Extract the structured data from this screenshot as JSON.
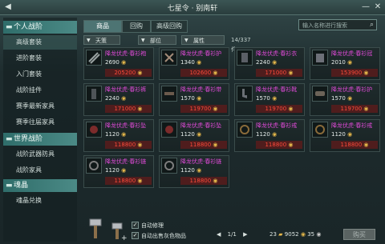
{
  "title": "七星令 · 别南轩",
  "sidebar": {
    "sections": [
      {
        "label": "个人战阶",
        "items": [
          {
            "label": "高级套装",
            "selected": true
          },
          {
            "label": "进阶套装"
          },
          {
            "label": "入门套装"
          },
          {
            "label": "战阶挂件"
          },
          {
            "label": "赛季最新家具"
          },
          {
            "label": "赛季往届家具"
          }
        ]
      },
      {
        "label": "世界战阶",
        "items": [
          {
            "label": "战阶武器防具"
          },
          {
            "label": "战阶家具"
          }
        ]
      },
      {
        "label": "魂晶",
        "items": [
          {
            "label": "魂晶兑换"
          }
        ]
      }
    ]
  },
  "tabs": [
    {
      "label": "商品",
      "active": true
    },
    {
      "label": "回购"
    },
    {
      "label": "高级回购"
    }
  ],
  "search": {
    "placeholder": "输入名称进行搜索"
  },
  "filters": {
    "cat": "天策",
    "part": "部位",
    "attr": "属性",
    "count": "14/337件"
  },
  "items": [
    {
      "name": "降龙伏虎·春衫袍",
      "qty": "2690",
      "price": "205200"
    },
    {
      "name": "降龙伏虎·春衫护",
      "qty": "1340",
      "price": "102600"
    },
    {
      "name": "降龙伏虎·春衫衣",
      "qty": "2240",
      "price": "171000"
    },
    {
      "name": "降龙伏虎·春衫冠",
      "qty": "2010",
      "price": "153900"
    },
    {
      "name": "降龙伏虎·春衫裤",
      "qty": "2240",
      "price": "171000"
    },
    {
      "name": "降龙伏虎·春衫带",
      "qty": "1570",
      "price": "119700"
    },
    {
      "name": "降龙伏虎·春衫靴",
      "qty": "1570",
      "price": "119700"
    },
    {
      "name": "降龙伏虎·春衫护",
      "qty": "1570",
      "price": "119700"
    },
    {
      "name": "降龙伏虎·春衫坠",
      "qty": "1120",
      "price": "118800"
    },
    {
      "name": "降龙伏虎·春衫坠",
      "qty": "1120",
      "price": "118800"
    },
    {
      "name": "降龙伏虎·春衫戒",
      "qty": "1120",
      "price": "118800"
    },
    {
      "name": "降龙伏虎·春衫戒",
      "qty": "1120",
      "price": "118800"
    },
    {
      "name": "降龙伏虎·春衫链",
      "qty": "1120",
      "price": "118800"
    },
    {
      "name": "降龙伏虎·春衫链",
      "qty": "1120",
      "price": "118800"
    }
  ],
  "footer": {
    "auto_repair": "自动修理",
    "auto_sell": "自动出售灰色物品",
    "pager": "1/1",
    "cur1": "23",
    "cur2": "9052",
    "cur3": "35",
    "buy": "购买"
  }
}
